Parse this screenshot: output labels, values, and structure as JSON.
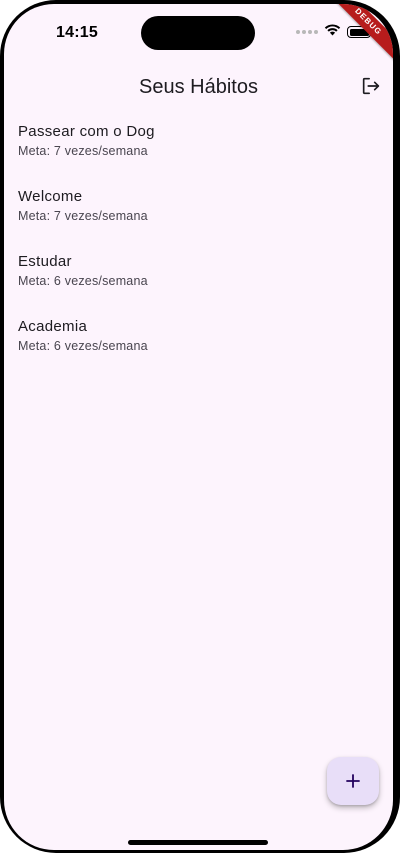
{
  "status_bar": {
    "time": "14:15",
    "icons": [
      "cellular-signal-icon",
      "wifi-icon",
      "battery-icon"
    ]
  },
  "debug_banner": "DEBUG",
  "app_bar": {
    "title": "Seus Hábitos",
    "actions": [
      {
        "icon": "logout-icon"
      }
    ]
  },
  "habits": [
    {
      "name": "Passear com o Dog",
      "goal": "Meta: 7 vezes/semana"
    },
    {
      "name": "Welcome",
      "goal": "Meta: 7 vezes/semana"
    },
    {
      "name": "Estudar",
      "goal": "Meta: 6 vezes/semana"
    },
    {
      "name": "Academia",
      "goal": "Meta: 6 vezes/semana"
    }
  ],
  "fab": {
    "icon": "plus-icon"
  },
  "colors": {
    "background": "#fdf4fd",
    "fab_background": "#e8def8",
    "fab_icon": "#21005d",
    "text_primary": "#1d1b20",
    "text_secondary": "#49454f",
    "debug_ribbon": "#b71c1c"
  }
}
